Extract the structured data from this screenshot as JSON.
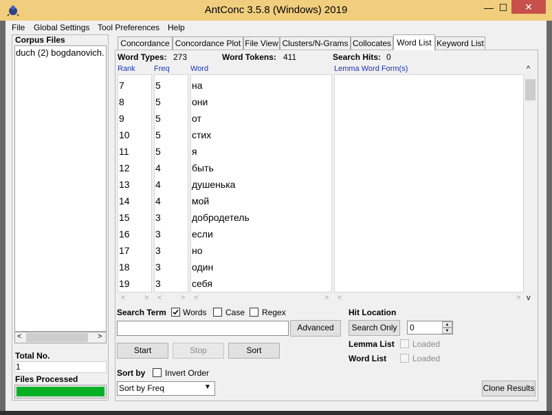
{
  "window": {
    "title": "AntConc 3.5.8 (Windows) 2019",
    "minimize": "—",
    "maximize": "☐",
    "close": "✕"
  },
  "menu": [
    "File",
    "Global Settings",
    "Tool Preferences",
    "Help"
  ],
  "corpus": {
    "title": "Corpus Files",
    "files": [
      "duch (2) bogdanovich."
    ],
    "total_label": "Total No.",
    "total_value": "1",
    "processed_label": "Files Processed",
    "progress": 1.0
  },
  "tabs": [
    "Concordance",
    "Concordance Plot",
    "File View",
    "Clusters/N-Grams",
    "Collocates",
    "Word List",
    "Keyword List"
  ],
  "active_tab": "Word List",
  "stats": {
    "types_label": "Word Types:",
    "types_value": "273",
    "tokens_label": "Word Tokens:",
    "tokens_value": "411",
    "hits_label": "Search Hits:",
    "hits_value": "0"
  },
  "columns": {
    "rank": "Rank",
    "freq": "Freq",
    "word": "Word",
    "lemma": "Lemma Word Form(s)"
  },
  "rows": [
    {
      "rank": "7",
      "freq": "5",
      "word": "на"
    },
    {
      "rank": "8",
      "freq": "5",
      "word": "они"
    },
    {
      "rank": "9",
      "freq": "5",
      "word": "от"
    },
    {
      "rank": "10",
      "freq": "5",
      "word": "стих"
    },
    {
      "rank": "11",
      "freq": "5",
      "word": "я"
    },
    {
      "rank": "12",
      "freq": "4",
      "word": "быть"
    },
    {
      "rank": "13",
      "freq": "4",
      "word": "душенька"
    },
    {
      "rank": "14",
      "freq": "4",
      "word": "мой"
    },
    {
      "rank": "15",
      "freq": "3",
      "word": "добродетель"
    },
    {
      "rank": "16",
      "freq": "3",
      "word": "если"
    },
    {
      "rank": "17",
      "freq": "3",
      "word": "но"
    },
    {
      "rank": "18",
      "freq": "3",
      "word": "один"
    },
    {
      "rank": "19",
      "freq": "3",
      "word": "себя"
    }
  ],
  "search": {
    "term_label": "Search Term",
    "words_label": "Words",
    "words_checked": true,
    "case_label": "Case",
    "regex_label": "Regex",
    "input_value": "",
    "advanced_label": "Advanced"
  },
  "buttons": {
    "start": "Start",
    "stop": "Stop",
    "sort": "Sort",
    "search_only": "Search Only",
    "clone": "Clone Results"
  },
  "hit_location": {
    "label": "Hit Location",
    "value": "0"
  },
  "lemma": {
    "list_label": "Lemma List",
    "word_list_label": "Word List",
    "loaded": "Loaded"
  },
  "sort": {
    "label": "Sort by",
    "invert_label": "Invert Order",
    "selected": "Sort by Freq"
  }
}
